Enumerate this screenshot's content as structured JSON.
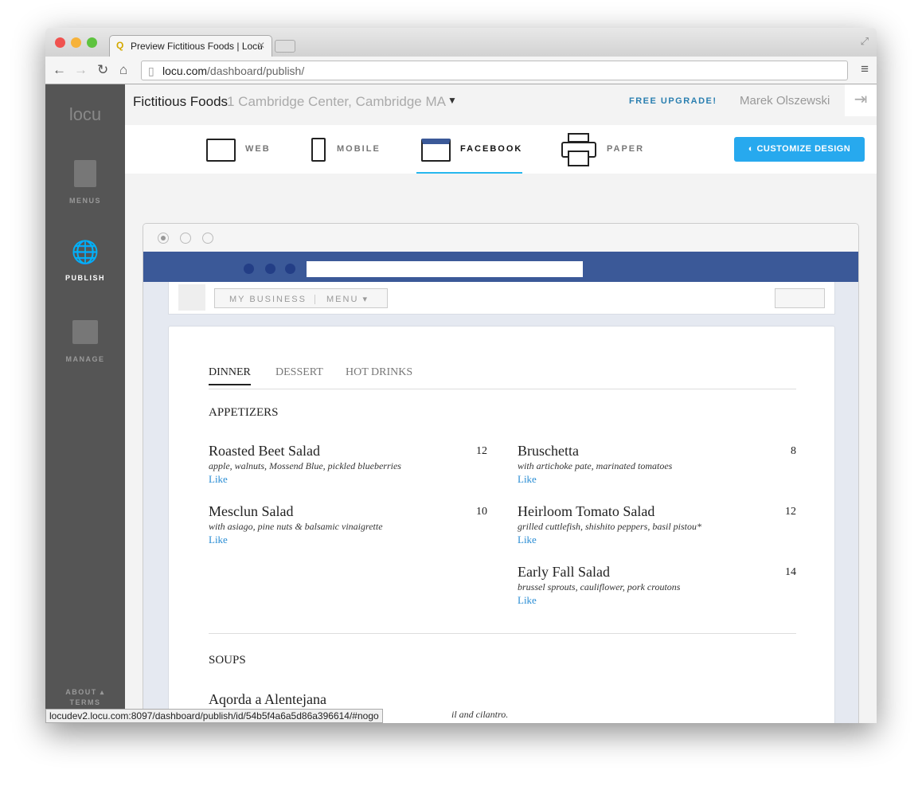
{
  "browser": {
    "tab_title": "Preview Fictitious Foods | Locu",
    "url_host": "locu.com",
    "url_path": "/dashboard/publish/",
    "status_url": "locudev2.locu.com:8097/dashboard/publish/id/54b5f4a6a5d86a396614/#nogo"
  },
  "sidebar": {
    "logo": "locu",
    "items": [
      {
        "label": "MENUS",
        "icon": "menu-icon"
      },
      {
        "label": "PUBLISH",
        "icon": "globe-icon",
        "active": true
      },
      {
        "label": "MANAGE",
        "icon": "store-icon"
      }
    ],
    "about": "ABOUT",
    "terms": "TERMS"
  },
  "header": {
    "business": "Fictitious Foods",
    "address": "1 Cambridge Center, Cambridge MA",
    "upgrade": "FREE UPGRADE!",
    "user": "Marek Olszewski"
  },
  "publish_tabs": [
    {
      "label": "WEB"
    },
    {
      "label": "MOBILE"
    },
    {
      "label": "FACEBOOK",
      "active": true
    },
    {
      "label": "PAPER"
    }
  ],
  "customize_label": "CUSTOMIZE DESIGN",
  "colors": {
    "accent": "#27a9ee",
    "facebook": "#3b5998",
    "link": "#2a8dd4"
  },
  "fb_nav": {
    "my_business": "MY BUSINESS",
    "menu": "MENU"
  },
  "menu": {
    "tabs": [
      "DINNER",
      "DESSERT",
      "HOT DRINKS"
    ],
    "active_tab": "DINNER",
    "like": "Like",
    "sections": [
      {
        "title": "APPETIZERS",
        "items": [
          {
            "name": "Roasted Beet Salad",
            "price": "12",
            "desc": "apple, walnuts, Mossend Blue, pickled blueberries"
          },
          {
            "name": "Bruschetta",
            "price": "8",
            "desc": "with artichoke pate, marinated tomatoes"
          },
          {
            "name": "Mesclun Salad",
            "price": "10",
            "desc": "with asiago, pine nuts & balsamic vinaigrette"
          },
          {
            "name": "Heirloom Tomato Salad",
            "price": "12",
            "desc": "grilled cuttlefish, shishito peppers, basil pistou*"
          },
          {
            "name": "Early Fall Salad",
            "price": "14",
            "desc": "brussel sprouts, cauliflower, pork croutons"
          }
        ]
      },
      {
        "title": "SOUPS",
        "items": [
          {
            "name": "Aqorda a Alentejana",
            "desc_tail": "il and cilantro."
          }
        ]
      }
    ]
  }
}
